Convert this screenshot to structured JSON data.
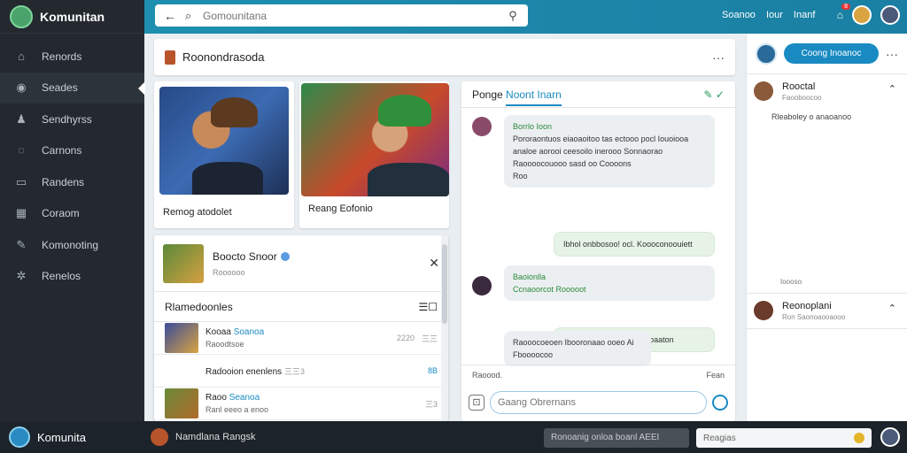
{
  "app": {
    "title": "Komunitan"
  },
  "sidebar": {
    "items": [
      {
        "label": "Renords",
        "icon": "home-icon"
      },
      {
        "label": "Seades",
        "icon": "target-icon"
      },
      {
        "label": "Sendhyrss",
        "icon": "user-icon"
      },
      {
        "label": "Carnons",
        "icon": "chat-icon"
      },
      {
        "label": "Randens",
        "icon": "calendar-icon"
      },
      {
        "label": "Coraom",
        "icon": "grid-icon"
      },
      {
        "label": "Komonoting",
        "icon": "pen-icon"
      },
      {
        "label": "Renelos",
        "icon": "settings-icon"
      }
    ]
  },
  "topbar": {
    "search_placeholder": "Gomounitana",
    "links": [
      "Soanoo",
      "Iour",
      "Inanf"
    ],
    "cart_badge": "8"
  },
  "post": {
    "title": "Roonondrasoda"
  },
  "cards": [
    {
      "caption": "Remog atodolet"
    },
    {
      "caption": "Reang Eofonio"
    }
  ],
  "popup": {
    "name": "Boocto Snoor",
    "sub": "Roooooo",
    "section_title": "Rlamedoonles",
    "rows": [
      {
        "title": "Kooaa",
        "title_hl": "Soanoa",
        "sub": "Raoodtsoe",
        "meta": "2220",
        "right": "三三"
      },
      {
        "title": "Radooion enenlens",
        "title_hl": "",
        "sub": "",
        "meta": "三三3",
        "right": "8B"
      },
      {
        "title": "Raoo",
        "title_hl": "Seanoa",
        "sub": "Ranl eeeo a enoo",
        "meta": "",
        "right": "三3"
      }
    ]
  },
  "chat": {
    "title_prefix": "Ponge",
    "title_tab": "Noont Inarn",
    "messages": [
      {
        "name": "Borrlo Ioon",
        "text": "Pororaontuos eiaoaoitoo tas ectooo pocl Iouoiooa analoe aorooi ceesoilo inerooo Sonnaorao",
        "meta": "Raoooocouooo sasd oo Coooons",
        "time": "Roo"
      },
      {
        "text": "Ibhol onbbosoo! ocl. Koooconoouiett"
      },
      {
        "name": "Baoionlla",
        "text": "Ccnaoorcot Rooooot",
        "meta": ""
      },
      {
        "text": "Rocoor ooogoos lolo loooaaton"
      },
      {
        "text": "Raooocoeoen Ibooronaao ooeo Ai Fboooocoo"
      }
    ],
    "footer_left": "Raoood.",
    "footer_right": "Fean",
    "input_placeholder": "Gaang Obrernans"
  },
  "right": {
    "button": "Coong Inoanoc",
    "s1_name": "Rooctal",
    "s1_sub": "Faooboocoo",
    "s1_item": "Rleaboley o anaoanoo",
    "s1_foot": "Ioooso",
    "s2_name": "Reonoplani",
    "s2_sub": "Ron Saonoaooaooo"
  },
  "bottombar": {
    "brand": "Komunita",
    "user": "Namdlana Rangsk",
    "status": "Ronoanig onloa boanl AEEI",
    "input": "Reagias"
  }
}
